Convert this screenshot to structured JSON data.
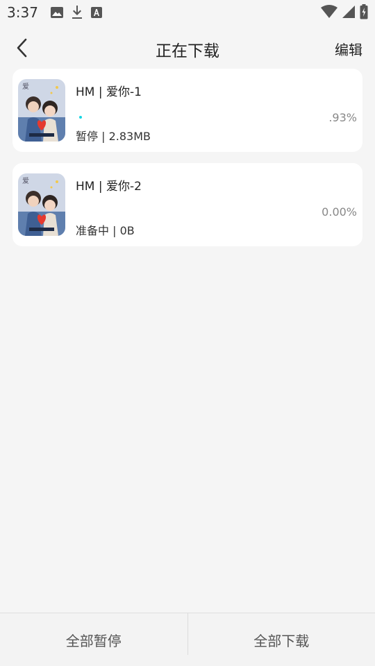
{
  "status_bar": {
    "time": "3:37",
    "left_icons": [
      "image-icon",
      "download-icon",
      "font-icon"
    ],
    "right_icons": [
      "wifi-icon",
      "signal-icon",
      "battery-icon"
    ]
  },
  "header": {
    "title": "正在下载",
    "edit_label": "编辑",
    "back_icon": "chevron-left-icon"
  },
  "downloads": [
    {
      "title": "HM | 爱你-1",
      "status": "暂停 | 2.83MB",
      "percent": ".93%",
      "progress_fraction": 0.0093
    },
    {
      "title": "HM | 爱你-2",
      "status": "准备中 | 0B",
      "percent": "0.00%",
      "progress_fraction": 0.0
    }
  ],
  "bottom_bar": {
    "pause_all_label": "全部暂停",
    "download_all_label": "全部下载"
  },
  "colors": {
    "background": "#f5f5f5",
    "card": "#ffffff",
    "progress": "#15d6e3",
    "secondary_text": "#888888"
  }
}
